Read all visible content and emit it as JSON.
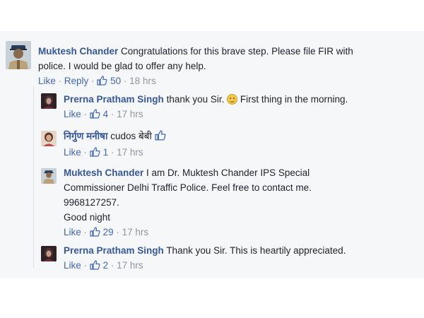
{
  "comments": [
    {
      "author": "Muktesh Chander",
      "text_line1": "Congratulations for this brave step. Please file FIR with",
      "text_line2": "police. I would be glad to offer any help.",
      "like": "Like",
      "reply": "Reply",
      "likes": "50",
      "time": "18 hrs",
      "avatar_icon": "police-officer-avatar"
    },
    {
      "author": "Prerna Pratham Singh",
      "text": "thank you Sir.",
      "text_after": "First thing in the morning.",
      "like": "Like",
      "likes": "4",
      "time": "17 hrs",
      "avatar_icon": "woman-avatar"
    },
    {
      "author": "निर्गुण मनीषा",
      "text": "cudos बेबी",
      "like": "Like",
      "likes": "1",
      "time": "17 hrs",
      "avatar_icon": "woman-avatar"
    },
    {
      "author": "Muktesh Chander",
      "text_line1": "I am Dr. Muktesh Chander IPS Special",
      "text_line2": "Commissioner Delhi Traffic Police. Feel free to contact me.",
      "text_line3": "9968127257.",
      "text_line4": "Good night",
      "like": "Like",
      "likes": "29",
      "time": "17 hrs",
      "avatar_icon": "police-officer-avatar"
    },
    {
      "author": "Prerna Pratham Singh",
      "text": "Thank you Sir. This is heartily appreciated.",
      "like": "Like",
      "likes": "2",
      "time": "17 hrs",
      "avatar_icon": "woman-avatar"
    }
  ],
  "separator": "·",
  "colors": {
    "author": "#365899",
    "link": "#4267b2",
    "meta": "#90949c",
    "panel": "#f6f7f9"
  }
}
